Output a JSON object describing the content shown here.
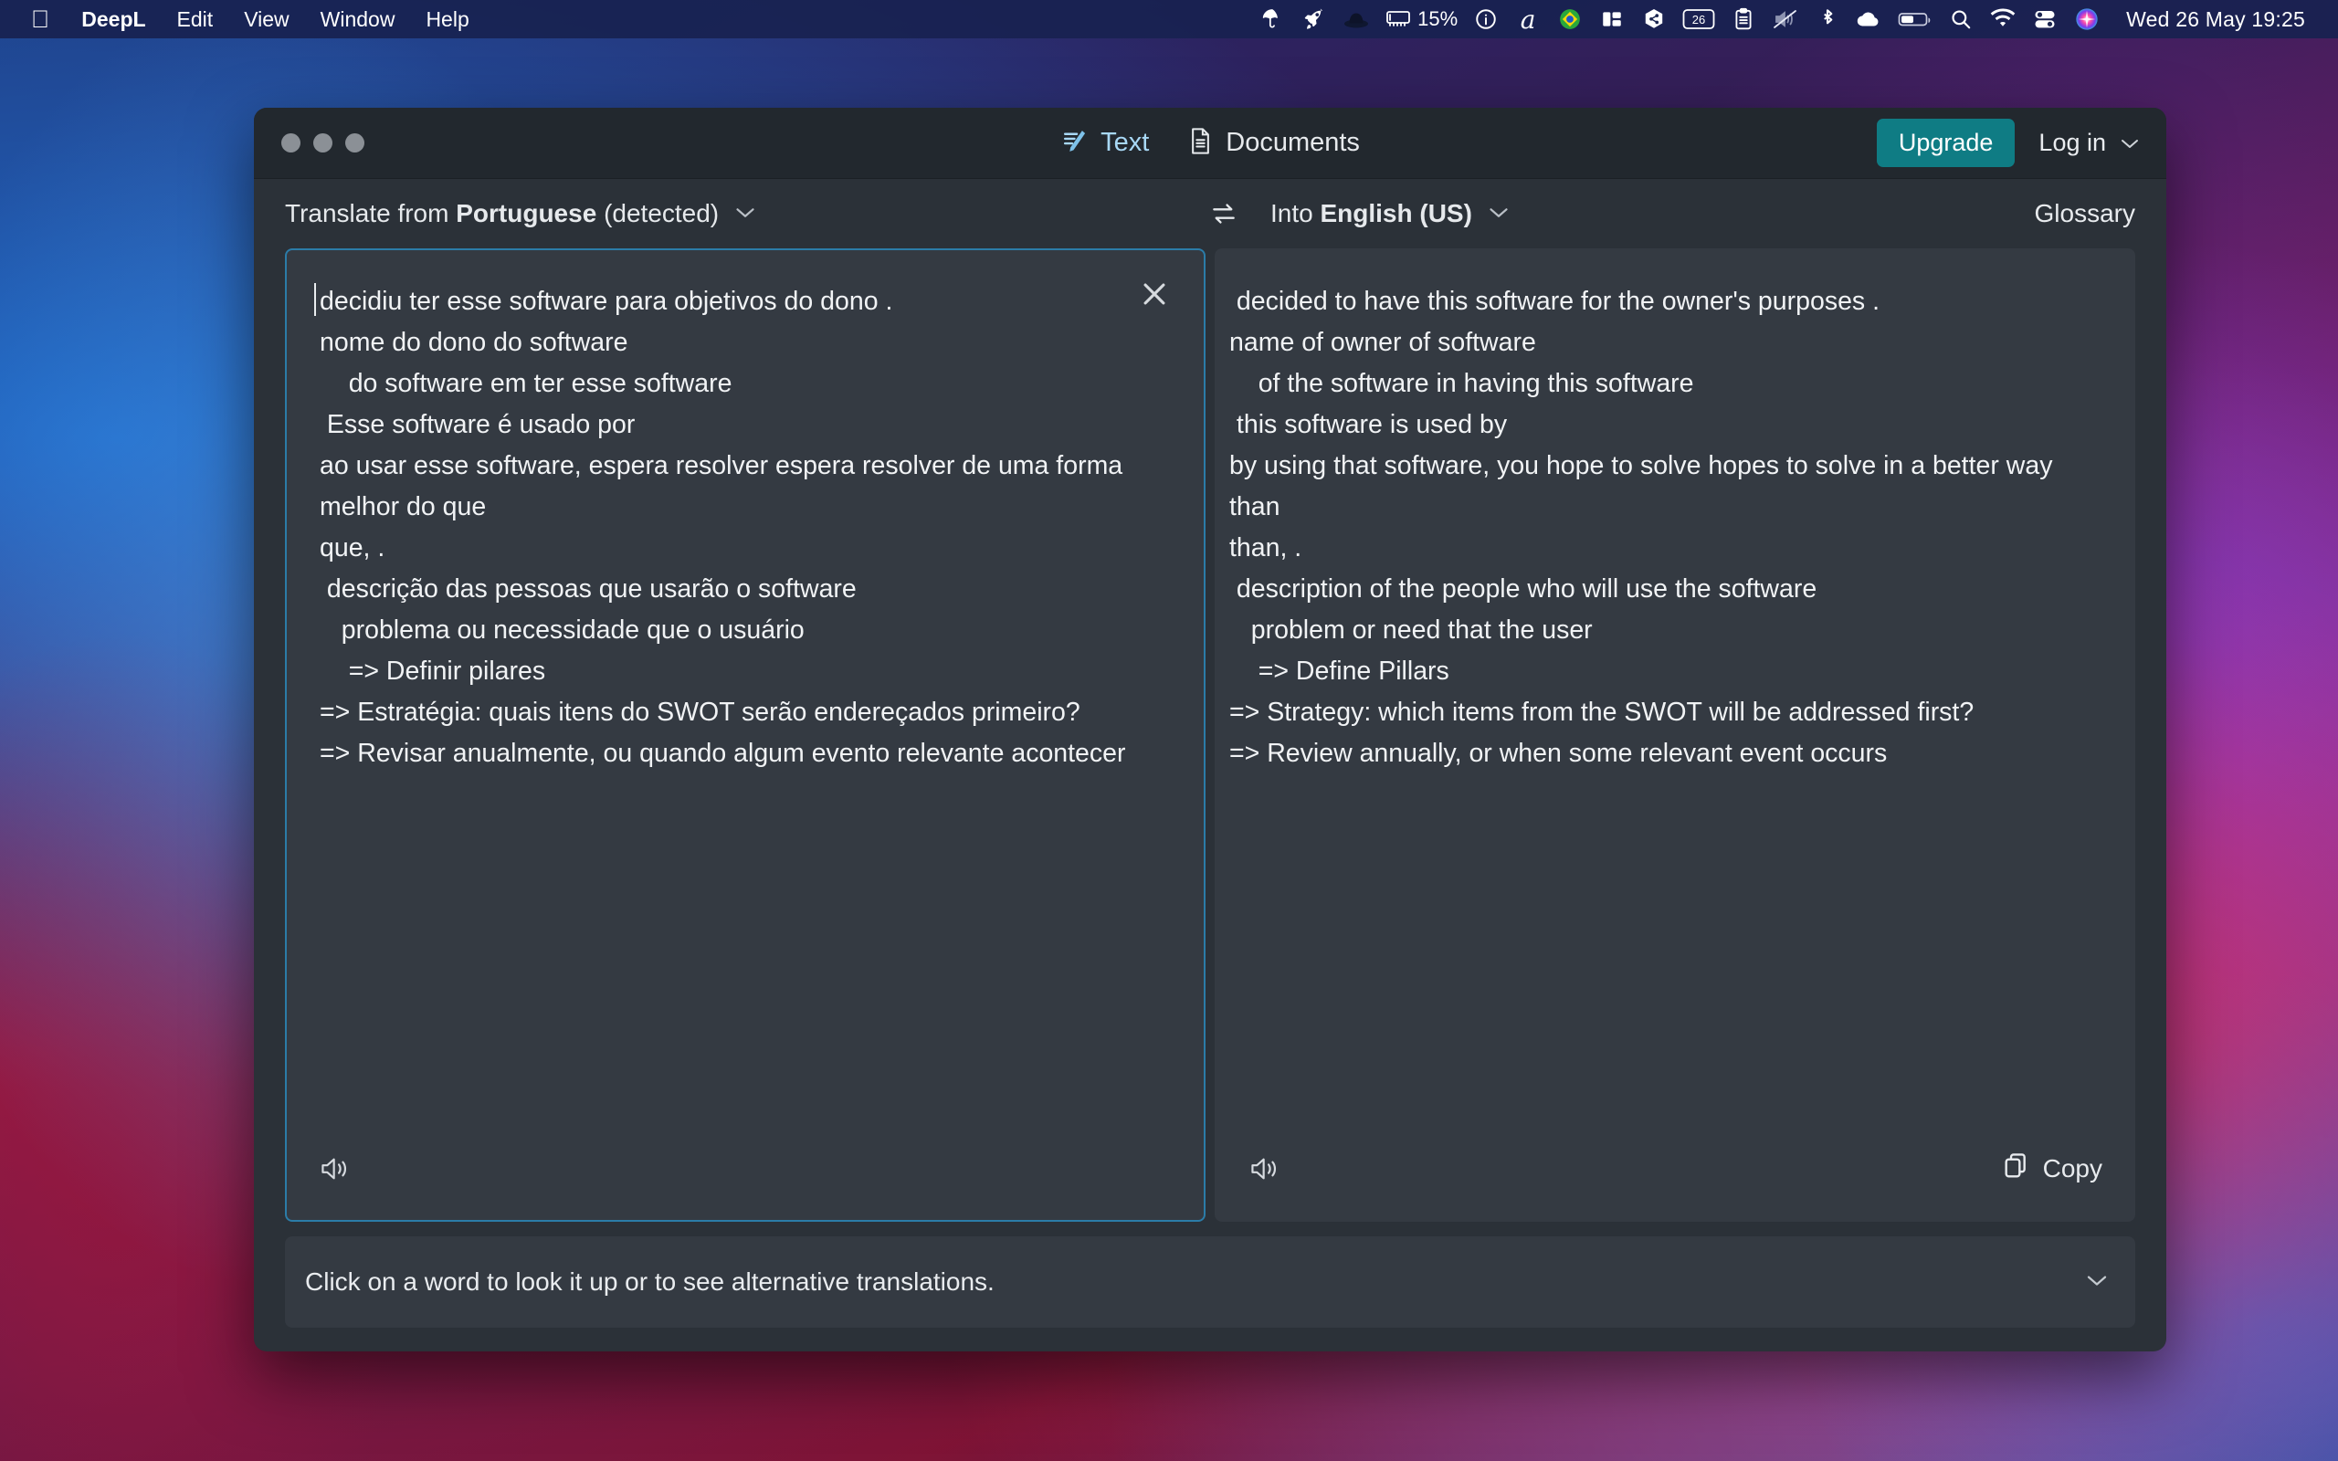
{
  "menubar": {
    "apple_icon": "apple-icon",
    "app_name": "DeepL",
    "items": [
      "Edit",
      "View",
      "Window",
      "Help"
    ],
    "status_icons": [
      {
        "name": "umbrella-icon"
      },
      {
        "name": "rocket-icon"
      },
      {
        "name": "bowler-hat-icon"
      },
      {
        "name": "memory-icon"
      },
      {
        "name": "info-circle-icon"
      },
      {
        "name": "cursive-a-icon"
      },
      {
        "name": "brazil-flag-icon"
      },
      {
        "name": "split-view-icon"
      },
      {
        "name": "share-node-icon"
      },
      {
        "name": "calendar-day-icon"
      },
      {
        "name": "clipboard-icon"
      },
      {
        "name": "mute-icon"
      },
      {
        "name": "bluetooth-icon"
      },
      {
        "name": "cloud-icon"
      },
      {
        "name": "battery-icon"
      },
      {
        "name": "search-icon"
      },
      {
        "name": "wifi-icon"
      },
      {
        "name": "control-center-icon"
      },
      {
        "name": "siri-icon"
      }
    ],
    "memory_percent": "15%",
    "calendar_day": "26",
    "clock": "Wed 26 May  19:25"
  },
  "window": {
    "tabs": [
      {
        "label": "Text",
        "icon": "text-translate-icon",
        "active": true
      },
      {
        "label": "Documents",
        "icon": "document-icon",
        "active": false
      }
    ],
    "upgrade_label": "Upgrade",
    "login_label": "Log in",
    "accent_color": "#0f7c84",
    "active_tab_color": "#a8d8f5",
    "border_color": "#2b7ca8"
  },
  "languages": {
    "source_prefix": "Translate from",
    "source_language": "Portuguese",
    "source_suffix": "(detected)",
    "swap_icon": "swap-languages-icon",
    "target_prefix": "Into",
    "target_language": "English (US)",
    "glossary_label": "Glossary"
  },
  "source_panel": {
    "text": "decidiu ter esse software para objetivos do dono .\nnome do dono do software\n    do software em ter esse software\n Esse software é usado por\nao usar esse software, espera resolver espera resolver de uma forma melhor do que\nque, .\n descrição das pessoas que usarão o software\n   problema ou necessidade que o usuário\n    => Definir pilares\n=> Estratégia: quais itens do SWOT serão endereçados primeiro?\n=> Revisar anualmente, ou quando algum evento relevante acontecer",
    "clear_icon": "close-icon",
    "speaker_icon": "speaker-icon"
  },
  "target_panel": {
    "text": " decided to have this software for the owner's purposes .\nname of owner of software\n    of the software in having this software\n this software is used by\nby using that software, you hope to solve hopes to solve in a better way than\nthan, .\n description of the people who will use the software\n   problem or need that the user\n    => Define Pillars\n=> Strategy: which items from the SWOT will be addressed first?\n=> Review annually, or when some relevant event occurs",
    "speaker_icon": "speaker-icon",
    "copy_label": "Copy",
    "copy_icon": "copy-icon"
  },
  "statusbar": {
    "hint": "Click on a word to look it up or to see alternative translations.",
    "chevron_icon": "chevron-down-icon"
  }
}
